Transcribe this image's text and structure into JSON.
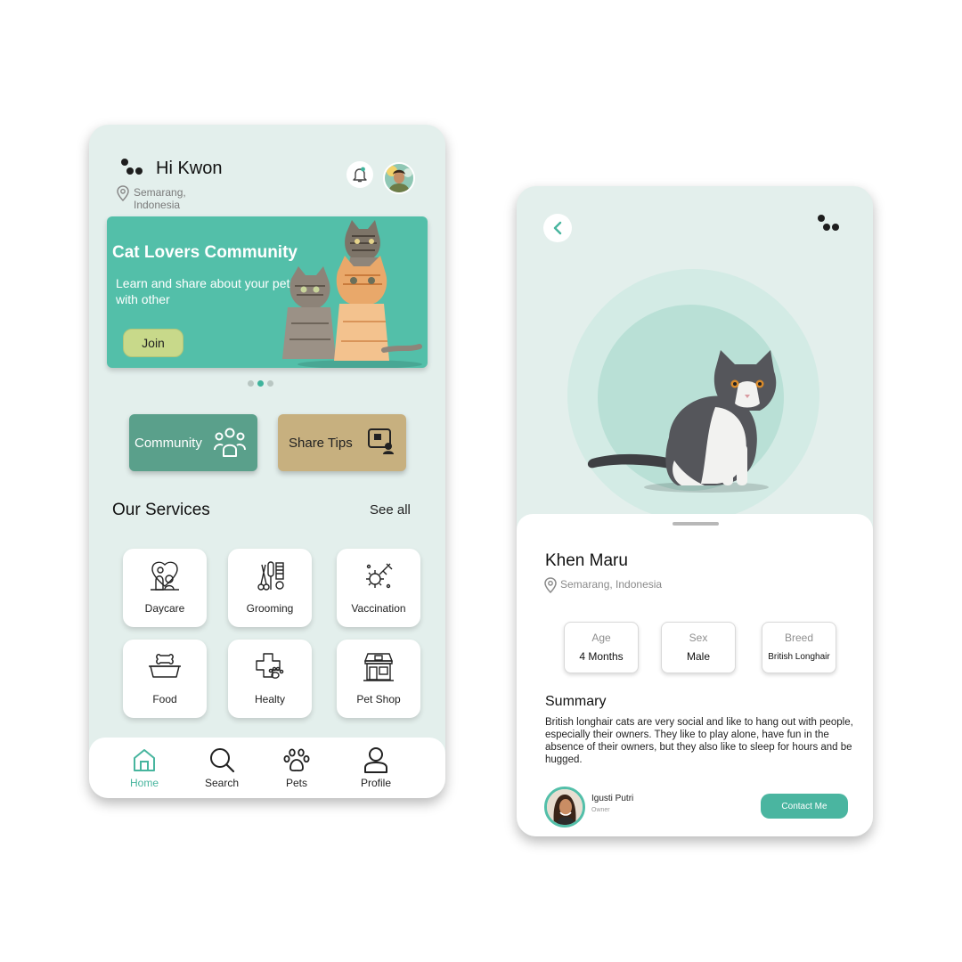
{
  "home": {
    "greeting": "Hi Kwon",
    "location_line1": "Semarang,",
    "location_line2": "Indonesia",
    "banner": {
      "title": "Cat Lovers Community",
      "subtitle": "Learn and share about your pet with other",
      "join_label": "Join",
      "pager_active_index": 1,
      "pager_count": 3
    },
    "actions": {
      "community_label": "Community",
      "share_tips_label": "Share Tips"
    },
    "services": {
      "title": "Our Services",
      "see_all": "See all",
      "items": [
        {
          "label": "Daycare",
          "icon": "daycare-icon"
        },
        {
          "label": "Grooming",
          "icon": "grooming-icon"
        },
        {
          "label": "Vaccination",
          "icon": "vaccination-icon"
        },
        {
          "label": "Food",
          "icon": "food-bowl-icon"
        },
        {
          "label": "Healty",
          "icon": "health-paw-icon"
        },
        {
          "label": "Pet Shop",
          "icon": "pet-shop-icon"
        }
      ]
    },
    "nav": [
      {
        "label": "Home",
        "icon": "home-icon",
        "active": true
      },
      {
        "label": "Search",
        "icon": "search-icon",
        "active": false
      },
      {
        "label": "Pets",
        "icon": "paw-icon",
        "active": false
      },
      {
        "label": "Profile",
        "icon": "profile-icon",
        "active": false
      }
    ]
  },
  "detail": {
    "pet_name": "Khen Maru",
    "location": "Semarang, Indonesia",
    "stats": [
      {
        "key": "Age",
        "value": "4 Months"
      },
      {
        "key": "Sex",
        "value": "Male"
      },
      {
        "key": "Breed",
        "value": "British Longhair"
      }
    ],
    "summary_title": "Summary",
    "summary_text": "British longhair cats are very social and like to hang out with people, especially their owners. They like to play alone, have fun in the absence of their owners, but they also like to sleep for hours and be hugged.",
    "owner_name": "Igusti Putri",
    "owner_role": "Owner",
    "contact_label": "Contact Me"
  },
  "colors": {
    "accent": "#53bfa9",
    "background": "#e3efec",
    "community": "#5aa08b",
    "share_tips": "#c7b07f",
    "join": "#c8d98a"
  }
}
